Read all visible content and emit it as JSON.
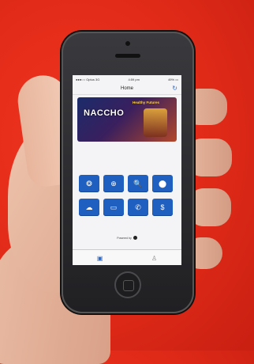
{
  "status_bar": {
    "carrier": "●●●○○ Optus 3G",
    "time": "4:59 pm",
    "battery": "49% ▭"
  },
  "nav": {
    "title": "Home"
  },
  "icons": {
    "refresh": "refresh-icon"
  },
  "banner": {
    "logo": "NACCHO",
    "headline": "Healthy Futures"
  },
  "tiles": [
    {
      "icon": "❂",
      "label": ""
    },
    {
      "icon": "⊕",
      "label": ""
    },
    {
      "icon": "🔍",
      "label": ""
    },
    {
      "icon": "⬤",
      "label": ""
    },
    {
      "icon": "☁",
      "label": ""
    },
    {
      "icon": "▭",
      "label": ""
    },
    {
      "icon": "✆",
      "label": ""
    },
    {
      "icon": "$",
      "label": ""
    }
  ],
  "footer": {
    "powered": "Powered by"
  },
  "tabs": {
    "home": "▣",
    "people": "♙"
  },
  "colors": {
    "background": "#e02a18",
    "tile": "#1f5fbf",
    "accent": "#2a6bcf"
  }
}
